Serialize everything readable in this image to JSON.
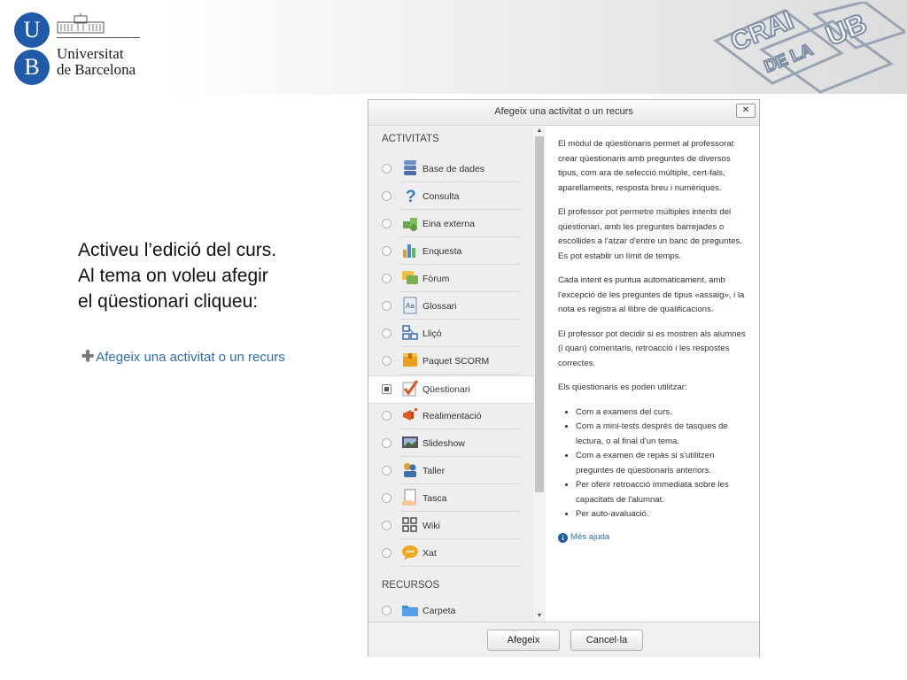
{
  "header": {
    "university_name_line1": "Universitat",
    "university_name_line2": "de Barcelona",
    "logo_letters": [
      "U",
      "B"
    ],
    "crai_logo_text": [
      "CRAI",
      "DE LA",
      "UB"
    ]
  },
  "intro": {
    "lines": [
      "Activeu l’edició del curs.",
      "Al tema on voleu afegir",
      "el qüestionari cliqueu:"
    ],
    "add_link": "Afegeix una activitat o un recurs"
  },
  "dialog": {
    "title": "Afegeix una activitat o un recurs",
    "close_label": "✕",
    "activities_heading": "ACTIVITATS",
    "resources_heading": "RECURSOS",
    "activities": [
      {
        "label": "Base de dades",
        "icon": "database-icon"
      },
      {
        "label": "Consulta",
        "icon": "question-icon"
      },
      {
        "label": "Eina externa",
        "icon": "puzzle-icon"
      },
      {
        "label": "Enquesta",
        "icon": "bar-chart-icon"
      },
      {
        "label": "Fòrum",
        "icon": "forum-icon"
      },
      {
        "label": "Glossari",
        "icon": "glossary-icon"
      },
      {
        "label": "Lliçó",
        "icon": "lesson-icon"
      },
      {
        "label": "Paquet SCORM",
        "icon": "package-icon"
      },
      {
        "label": "Qüestionari",
        "icon": "quiz-checkmark-icon",
        "selected": true
      },
      {
        "label": "Realimentació",
        "icon": "megaphone-icon"
      },
      {
        "label": "Slideshow",
        "icon": "slideshow-icon"
      },
      {
        "label": "Taller",
        "icon": "workshop-icon"
      },
      {
        "label": "Tasca",
        "icon": "assignment-icon"
      },
      {
        "label": "Wiki",
        "icon": "wiki-icon"
      },
      {
        "label": "Xat",
        "icon": "chat-icon"
      }
    ],
    "resources": [
      {
        "label": "Carpeta",
        "icon": "folder-icon"
      }
    ],
    "description": {
      "paragraphs": [
        "El mòdul de qüestionaris permet al professorat crear qüestionaris amb preguntes de diversos tipus, com ara de selecció múltiple, cert-fals, aparellaments, resposta breu i numèriques.",
        "El professor pot permetre múltiples intents del qüestionari, amb les preguntes barrejades o escollides a l'atzar d'entre un banc de preguntes. Es pot establir un límit de temps.",
        "Cada intent es puntua automàticament, amb l'excepció de les preguntes de tipus «assaig», i la nota es registra al llibre de qualificacions.",
        "El professor pot decidir si es mostren als alumnes (i quan) comentaris, retroacció i les respostes correctes.",
        "Els qüestionaris es poden utilitzar:"
      ],
      "bullets": [
        "Com a examens del curs.",
        "Com a mini-tests després de tasques de lectura, o al final d'un tema.",
        "Com a examen de repàs si s'utilitzen preguntes de qüestionaris anteriors.",
        "Per oferir retroacció immediata sobre les capacitats de l'alumnat.",
        "Per auto-avaluació."
      ],
      "more_help": "Més ajuda"
    },
    "buttons": {
      "add": "Afegeix",
      "cancel": "Cancel·la"
    }
  }
}
